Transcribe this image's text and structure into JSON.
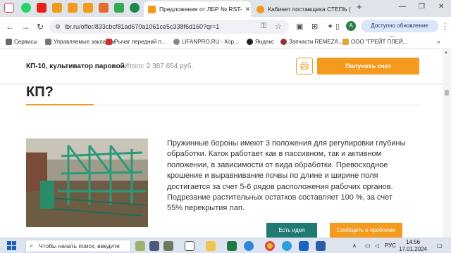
{
  "browser": {
    "active_tab_title": "Предложение от ЛБР № RST-",
    "second_tab_title": "Кабинет поставщика СТЕПЬ (",
    "url": "lbr.ru/offer/833cbcf81ad670a1061ce5c338f6d160?qr=1",
    "update_button": "Доступно обновление Chrome",
    "avatar_letter": "A",
    "bookmarks": [
      "Сервисы",
      "Управляемые закладки",
      "Рычаг передний п...",
      "LIFANPRO.RU - Кор...",
      "Яндекс",
      "Запчасти REMEZA...",
      "ООО \"ГРЕЙТ ПЛЕЙ..."
    ]
  },
  "offer": {
    "product_title": "КП-10, культиватор паровой",
    "total": "Итого: 2 387 654 руб.",
    "get_offer_button": "Получить счет",
    "section_heading": "КП?",
    "description": "Пружинные бороны имеют 3 положения для регулировки глубины обработки. Каток работает как в пассивном, так и активном положении, в зависимости от вида обработки. Превосходное крошение и выравнивание почвы по длине и ширине поля достигается за счет 5-6 рядов расположения рабочих органов. Подрезание растительных остатков составляет 100 %, за счет 55% перекрытия лап.",
    "idea_button": "Есть идея",
    "report_button": "Сообщить о проблеме"
  },
  "taskbar": {
    "search_placeholder": "Чтобы начать поиск, введите",
    "language": "РУС",
    "time": "14:56",
    "date": "17.01.2024"
  },
  "colors": {
    "accent": "#f39a1f",
    "teal": "#1f7a72"
  }
}
